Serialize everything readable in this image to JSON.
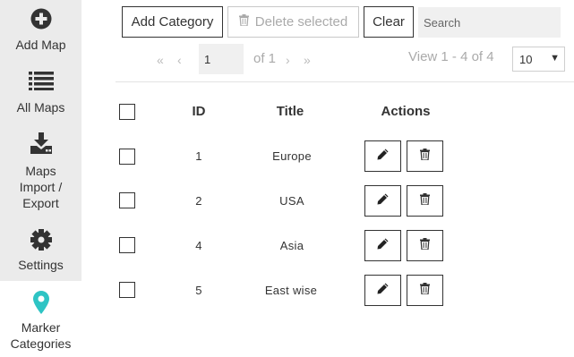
{
  "sidebar": {
    "items": [
      {
        "label": "Add Map",
        "icon": "plus-circle-icon"
      },
      {
        "label": "All Maps",
        "icon": "list-icon"
      },
      {
        "label": "Maps\nImport /\nExport",
        "icon": "download-icon"
      },
      {
        "label": "Settings",
        "icon": "gear-icon"
      },
      {
        "label": "Marker\nCategories",
        "icon": "map-marker-icon",
        "active": true
      }
    ]
  },
  "toolbar": {
    "add_label": "Add Category",
    "delete_label": "Delete selected",
    "clear_label": "Clear",
    "search_placeholder": "Search"
  },
  "pagination": {
    "page": "1",
    "of_text": "of 1",
    "view_text": "View 1 - 4 of 4",
    "page_size": "10"
  },
  "table": {
    "headers": {
      "id": "ID",
      "title": "Title",
      "actions": "Actions"
    },
    "rows": [
      {
        "id": "1",
        "title": "Europe"
      },
      {
        "id": "2",
        "title": "USA"
      },
      {
        "id": "4",
        "title": "Asia"
      },
      {
        "id": "5",
        "title": "East wise"
      }
    ]
  },
  "colors": {
    "accent": "#2ec4c4",
    "sidebar_bg": "#ebebeb",
    "text": "#333333"
  }
}
